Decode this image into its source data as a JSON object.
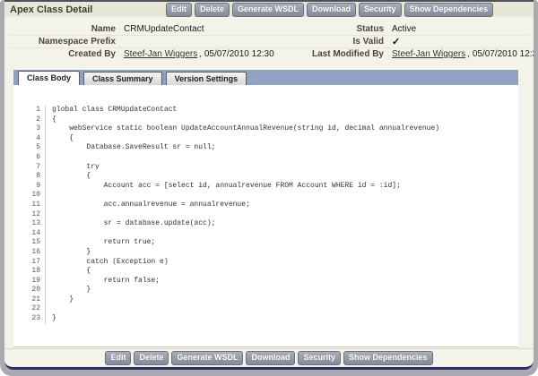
{
  "page": {
    "title": "Apex Class Detail"
  },
  "actions": [
    "Edit",
    "Delete",
    "Generate WSDL",
    "Download",
    "Security",
    "Show Dependencies"
  ],
  "details": {
    "rows": [
      {
        "left_label": "Name",
        "left_value": "CRMUpdateContact",
        "right_label": "Status",
        "right_value": "Active"
      },
      {
        "left_label": "Namespace Prefix",
        "left_value": "",
        "right_label": "Is Valid",
        "right_value": "✓"
      },
      {
        "left_label": "Created By",
        "left_link": "Steef-Jan Wiggers",
        "left_rest": ", 05/07/2010 12:30",
        "right_label": "Last Modified By",
        "right_link": "Steef-Jan Wiggers",
        "right_rest": ", 05/07/2010 12:30"
      }
    ]
  },
  "tabs": [
    {
      "label": "Class Body",
      "active": true
    },
    {
      "label": "Class Summary",
      "active": false
    },
    {
      "label": "Version Settings",
      "active": false
    }
  ],
  "code": {
    "line_numbers": [
      1,
      2,
      3,
      4,
      5,
      6,
      7,
      8,
      9,
      10,
      11,
      12,
      13,
      14,
      15,
      16,
      17,
      18,
      19,
      20,
      21,
      22,
      23
    ],
    "lines": [
      "global class CRMUpdateContact",
      "{",
      "    webService static boolean UpdateAccountAnnualRevenue(string id, decimal annualrevenue)",
      "    {",
      "        Database.SaveResult sr = null;",
      "",
      "        try",
      "        {",
      "            Account acc = [select id, annualrevenue FROM Account WHERE id = :id];",
      "",
      "            acc.annualrevenue = annualrevenue;",
      "",
      "            sr = database.update(acc);",
      "",
      "            return true;",
      "        }",
      "        catch (Exception e)",
      "        {",
      "            return false;",
      "        }",
      "    }",
      "",
      "}"
    ]
  },
  "colors": {
    "frame": "#a9a9b1",
    "page_background": "#f4f3ea",
    "header_background": "#e7e7d8",
    "button_background": "#8a8f9b",
    "button_text": "#ffffff",
    "tab_band": "#8fa2c2",
    "bottom_border": "#2a2e62",
    "code_text": "#333333"
  }
}
